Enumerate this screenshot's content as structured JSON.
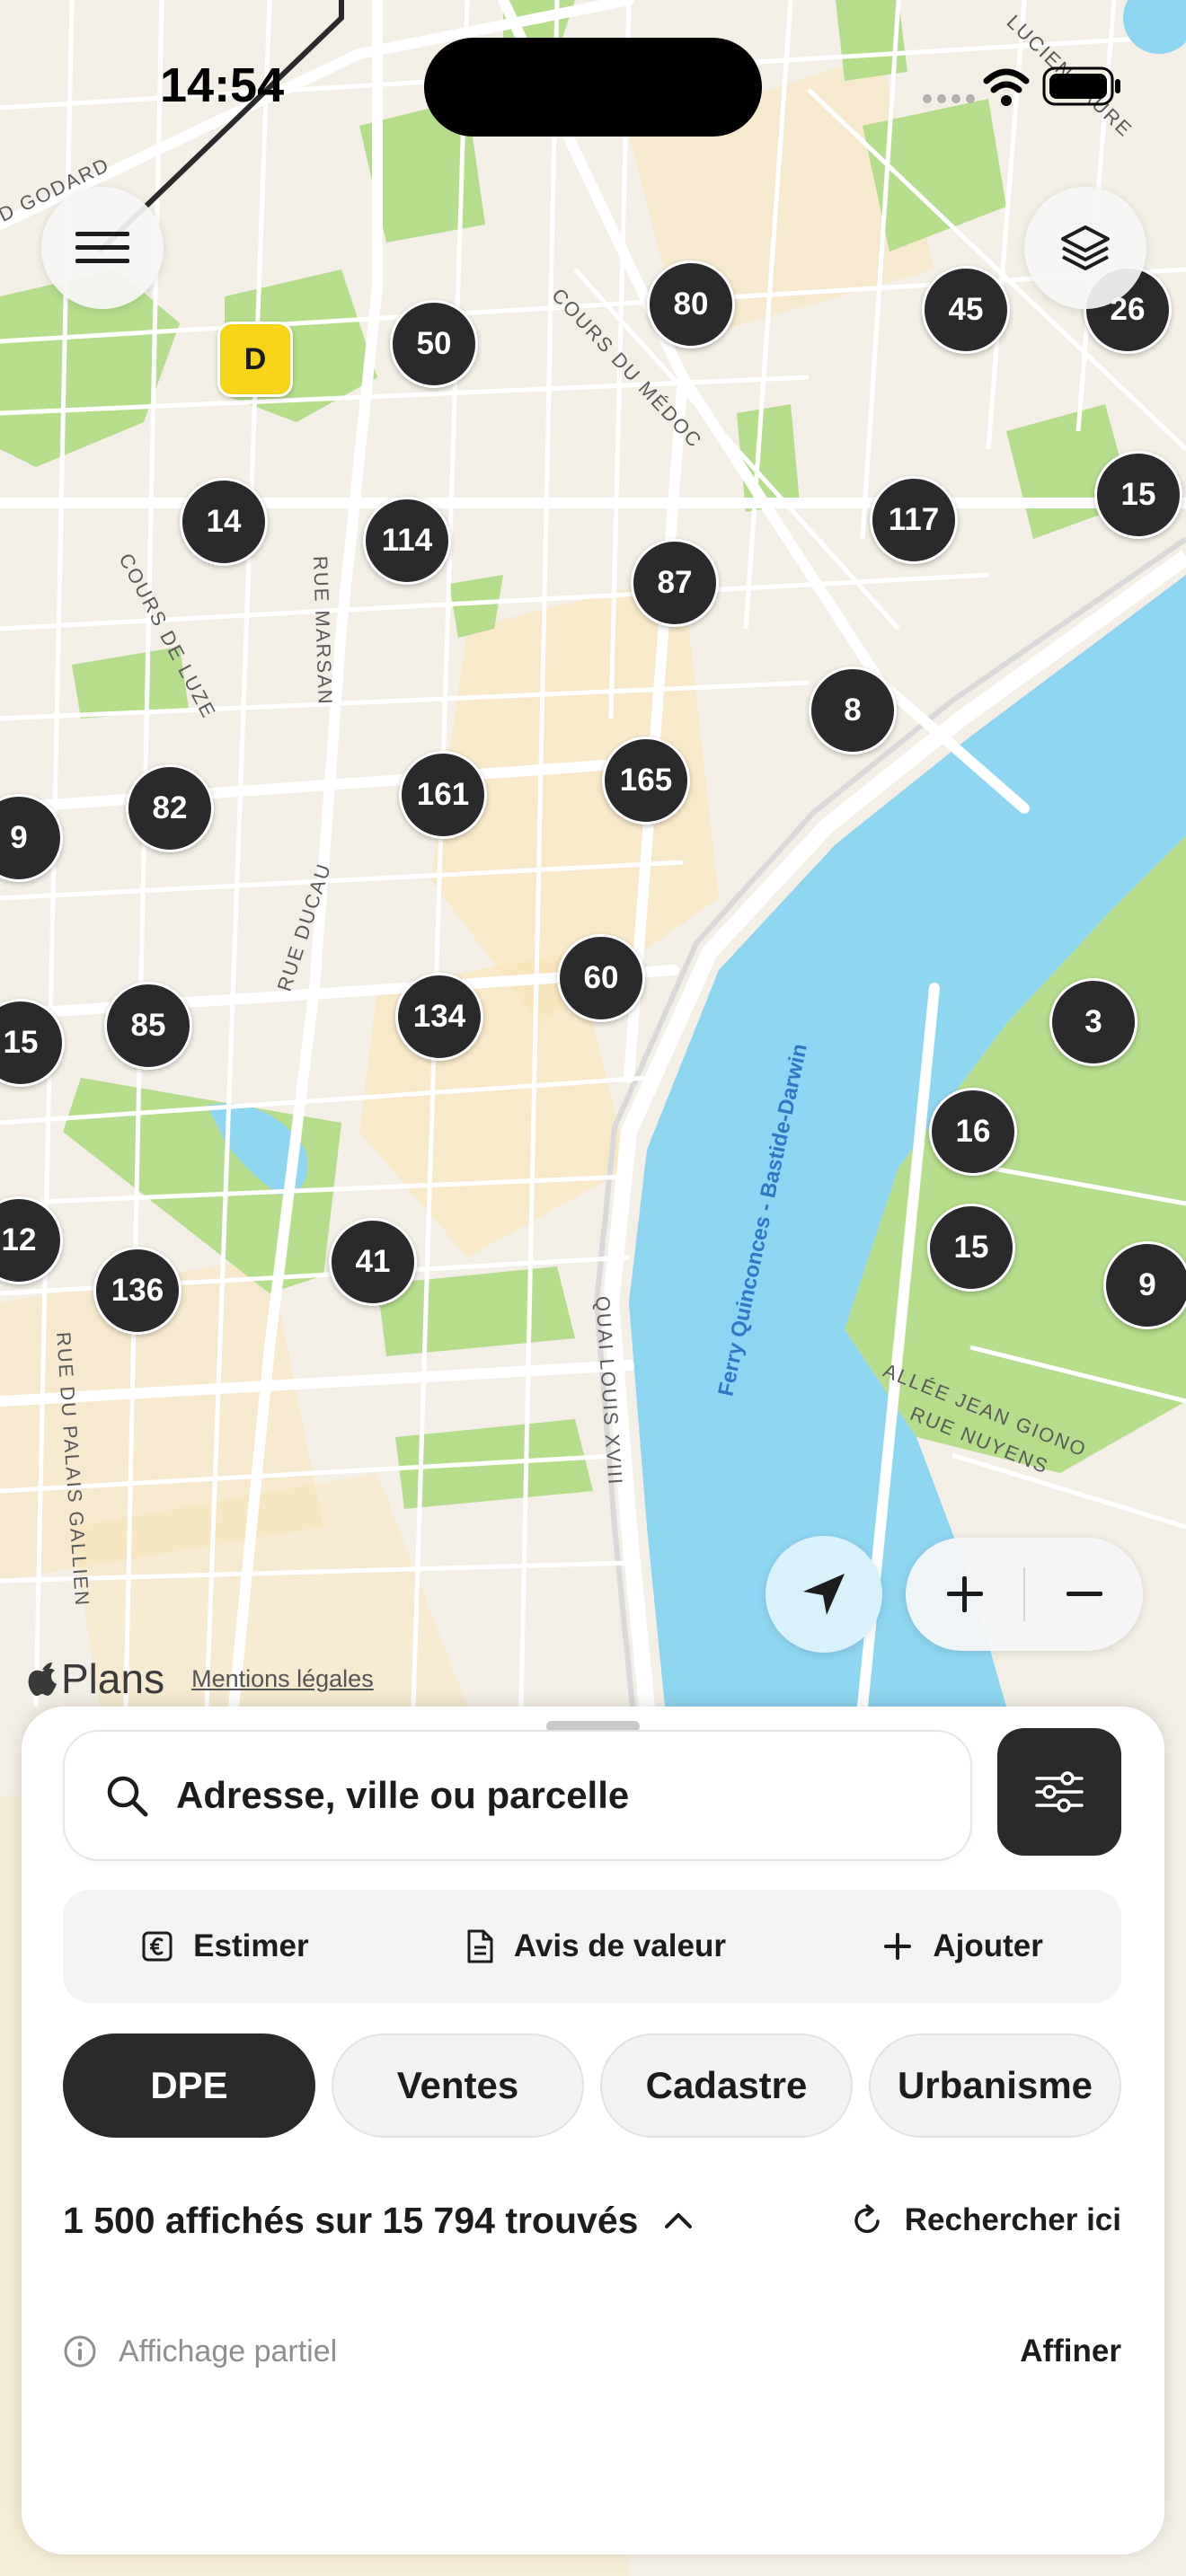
{
  "status_bar": {
    "time": "14:54"
  },
  "map": {
    "street_labels": [
      "COURS DU MÉDOC",
      "COURS DE LUZE",
      "RUE MARSAN",
      "RUE DUCAU",
      "QUAI LOUIS XVIII",
      "RUE DU PALAIS GALLIEN",
      "ALLÉE JEAN GIONO",
      "RUE NUYENS",
      "LUCIEN FAURE",
      "D GODARD"
    ],
    "ferry_label": "Ferry Quinconces - Bastide-Darwin",
    "dpe_marker": "D",
    "clusters": [
      "80",
      "45",
      "26",
      "50",
      "15",
      "14",
      "114",
      "117",
      "87",
      "8",
      "165",
      "9",
      "82",
      "161",
      "60",
      "15",
      "85",
      "134",
      "3",
      "16",
      "12",
      "15",
      "41",
      "136",
      "9"
    ],
    "attribution": {
      "logo_text": "Plans",
      "legal_link": "Mentions légales"
    }
  },
  "controls": {
    "menu_icon": "hamburger-icon",
    "layers_icon": "layers-icon",
    "locate_icon": "location-arrow-icon",
    "zoom_in": "+",
    "zoom_out": "−"
  },
  "sheet": {
    "search": {
      "placeholder": "Adresse, ville ou parcelle"
    },
    "actions": [
      {
        "label": "Estimer",
        "icon": "euro-icon"
      },
      {
        "label": "Avis de valeur",
        "icon": "document-icon"
      },
      {
        "label": "Ajouter",
        "icon": "plus-icon"
      }
    ],
    "chips": [
      {
        "label": "DPE",
        "active": true
      },
      {
        "label": "Ventes",
        "active": false
      },
      {
        "label": "Cadastre",
        "active": false
      },
      {
        "label": "Urbanisme",
        "active": false
      }
    ],
    "results_text": "1 500 affichés sur 15 794 trouvés",
    "search_here": "Rechercher ici",
    "info_text": "Affichage partiel",
    "refine": "Affiner"
  },
  "colors": {
    "map_land": "#f3efe6",
    "water": "#8ed5f2",
    "park": "#b5dd8b",
    "cluster": "#2a2a2c",
    "dpe_yellow": "#f7d417",
    "accent_dark": "#2a2a2c"
  }
}
